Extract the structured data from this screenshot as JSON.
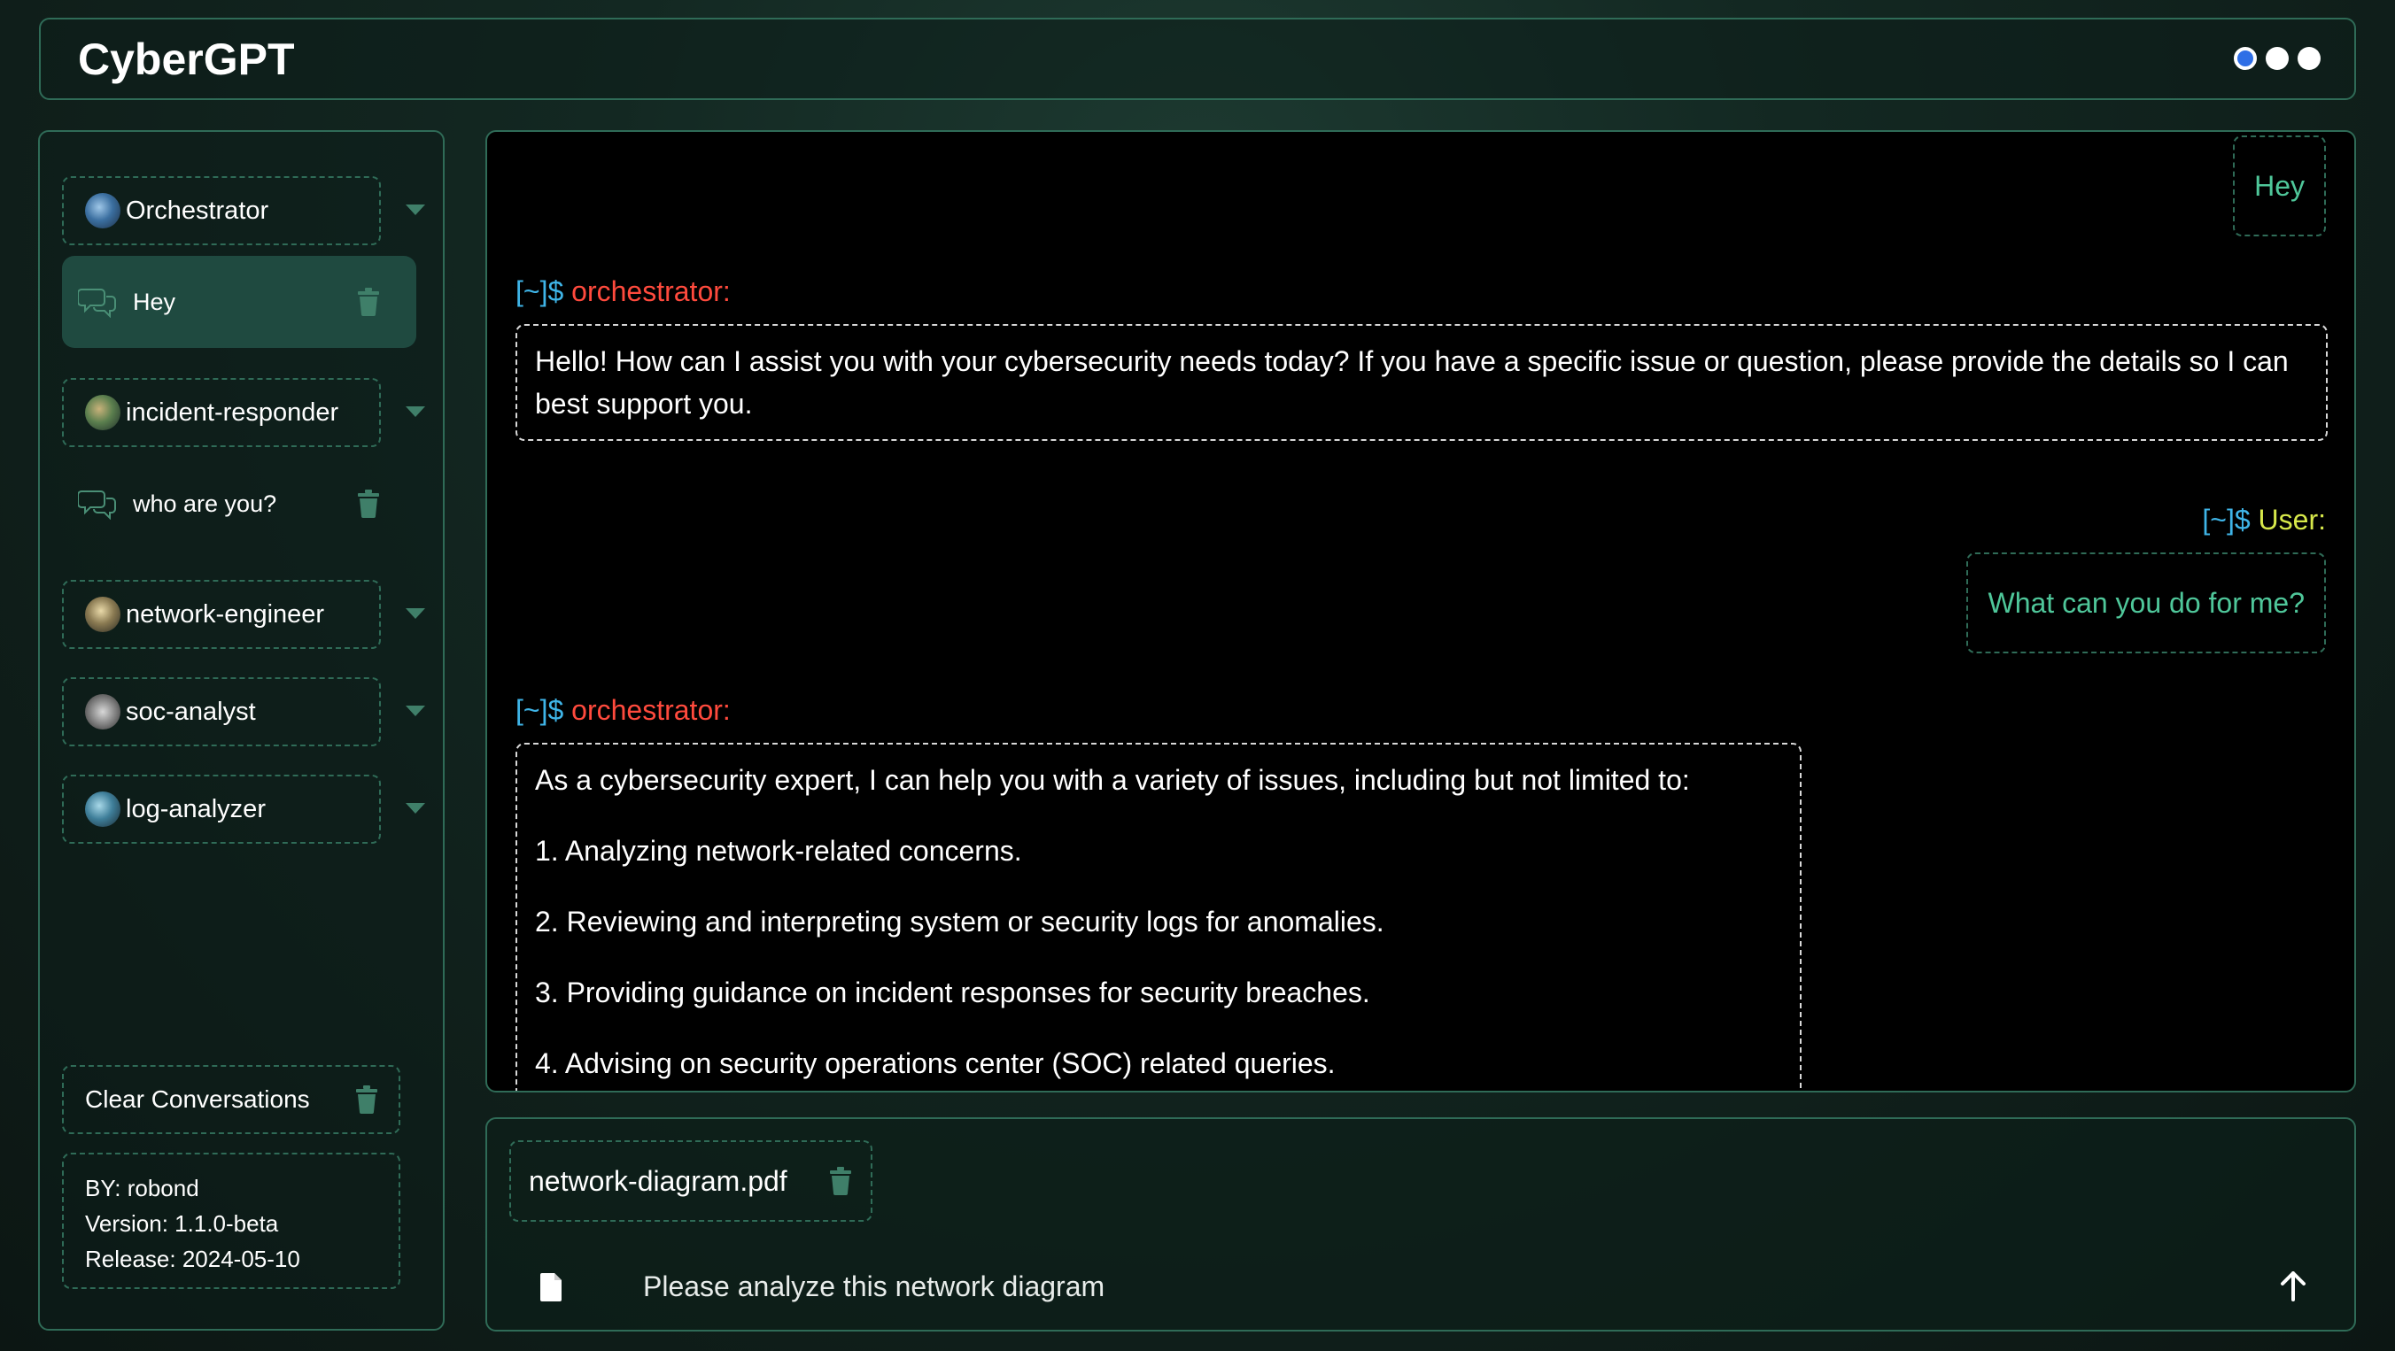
{
  "app": {
    "title": "CyberGPT"
  },
  "header": {
    "pager_dots": 3,
    "active_dot": 1
  },
  "sidebar": {
    "agents": [
      {
        "name": "Orchestrator",
        "conversations": [
          {
            "title": "Hey",
            "active": true
          }
        ]
      },
      {
        "name": "incident-responder",
        "conversations": [
          {
            "title": "who are you?",
            "active": false
          }
        ]
      },
      {
        "name": "network-engineer",
        "conversations": []
      },
      {
        "name": "soc-analyst",
        "conversations": []
      },
      {
        "name": "log-analyzer",
        "conversations": []
      }
    ],
    "clear_label": "Clear Conversations",
    "about": {
      "by": "BY: robond",
      "version": "Version: 1.1.0-beta",
      "release": "Release: 2024-05-10"
    }
  },
  "chat": {
    "prompt_cwd": "[~]$",
    "messages": [
      {
        "role": "user",
        "text": "Hey"
      },
      {
        "role": "assistant",
        "speaker": "orchestrator:",
        "paragraphs": [
          "Hello! How can I assist you with your cybersecurity needs today? If you have a specific issue or question, please provide the details so I can best support you."
        ]
      },
      {
        "role": "user",
        "speaker": "User:",
        "text": "What can you do for me?"
      },
      {
        "role": "assistant",
        "speaker": "orchestrator:",
        "paragraphs": [
          "As a cybersecurity expert, I can help you with a variety of issues, including but not limited to:",
          "1. Analyzing network-related concerns.",
          "2. Reviewing and interpreting system or security logs for anomalies.",
          "3. Providing guidance on incident responses for security breaches.",
          "4. Advising on security operations center (SOC) related queries."
        ]
      }
    ]
  },
  "composer": {
    "attachment_name": "network-diagram.pdf",
    "input_value": "Please analyze this network diagram"
  },
  "colors": {
    "accent_border": "#2f6b57",
    "prompt_cwd": "#3fb5e8",
    "agent_name": "#ff4a3d",
    "user_name": "#d7e84a",
    "user_text": "#4fc79a"
  },
  "icons": [
    "agent-avatar",
    "chat-bubbles-icon",
    "trash-icon",
    "chevron-down-icon",
    "file-icon",
    "arrow-up-icon"
  ]
}
